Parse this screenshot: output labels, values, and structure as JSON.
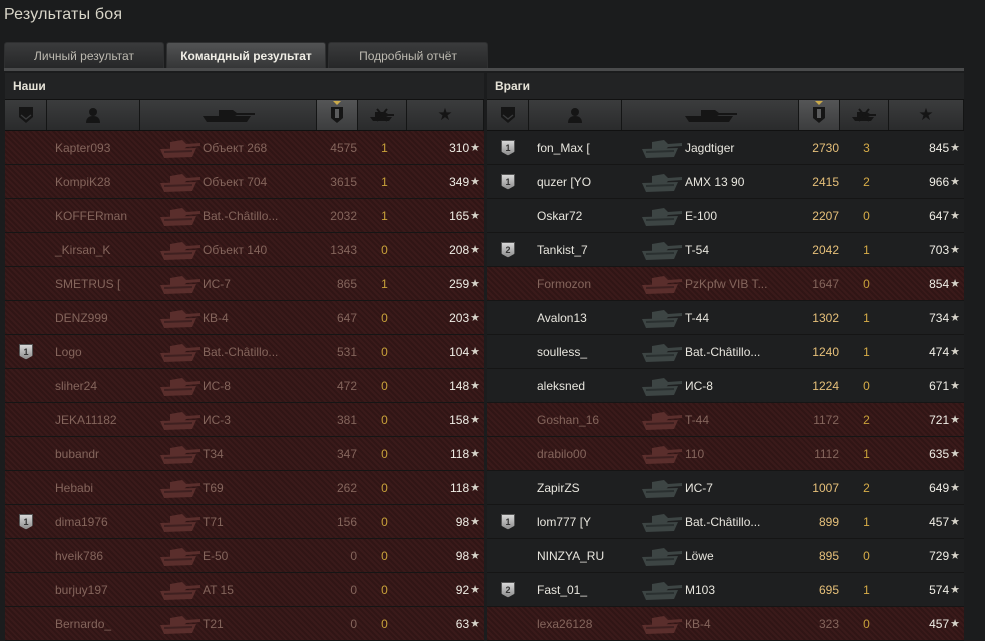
{
  "window": {
    "title": "Результаты боя"
  },
  "tabs": [
    {
      "label": "Личный результат",
      "active": false
    },
    {
      "label": "Командный результат",
      "active": true
    },
    {
      "label": "Подробный отчёт",
      "active": false
    }
  ],
  "columns": [
    "badge-icon",
    "player-icon",
    "tank-icon",
    "damage-icon",
    "kills-icon",
    "xp-star-icon"
  ],
  "ours": {
    "title": "Наши",
    "rows": [
      {
        "badge": "",
        "name": "Kapter093",
        "tank": "Объект 268",
        "damage": "4575",
        "kills": "1",
        "xp": "310",
        "alive": false
      },
      {
        "badge": "",
        "name": "KompiK28",
        "tank": "Объект 704",
        "damage": "3615",
        "kills": "1",
        "xp": "349",
        "alive": false
      },
      {
        "badge": "",
        "name": "KOFFERman",
        "tank": "Bat.-Châtillo...",
        "damage": "2032",
        "kills": "1",
        "xp": "165",
        "alive": false
      },
      {
        "badge": "",
        "name": "_Kirsan_K",
        "tank": "Объект 140",
        "damage": "1343",
        "kills": "0",
        "xp": "208",
        "alive": false
      },
      {
        "badge": "",
        "name": "SMETRUS [",
        "tank": "ИС-7",
        "damage": "865",
        "kills": "1",
        "xp": "259",
        "alive": false
      },
      {
        "badge": "",
        "name": "DENZ999",
        "tank": "КВ-4",
        "damage": "647",
        "kills": "0",
        "xp": "203",
        "alive": false
      },
      {
        "badge": "1",
        "name": "Logo",
        "tank": "Bat.-Châtillo...",
        "damage": "531",
        "kills": "0",
        "xp": "104",
        "alive": false
      },
      {
        "badge": "",
        "name": "sliher24",
        "tank": "ИС-8",
        "damage": "472",
        "kills": "0",
        "xp": "148",
        "alive": false
      },
      {
        "badge": "",
        "name": "JEKA11182",
        "tank": "ИС-3",
        "damage": "381",
        "kills": "0",
        "xp": "158",
        "alive": false
      },
      {
        "badge": "",
        "name": "bubandr",
        "tank": "T34",
        "damage": "347",
        "kills": "0",
        "xp": "118",
        "alive": false
      },
      {
        "badge": "",
        "name": "Hebabi",
        "tank": "T69",
        "damage": "262",
        "kills": "0",
        "xp": "118",
        "alive": false
      },
      {
        "badge": "1",
        "name": "dima1976",
        "tank": "T71",
        "damage": "156",
        "kills": "0",
        "xp": "98",
        "alive": false
      },
      {
        "badge": "",
        "name": "hveik786",
        "tank": "E-50",
        "damage": "0",
        "kills": "0",
        "xp": "98",
        "alive": false
      },
      {
        "badge": "",
        "name": "burjuy197",
        "tank": "AT 15",
        "damage": "0",
        "kills": "0",
        "xp": "92",
        "alive": false
      },
      {
        "badge": "",
        "name": "Bernardo_",
        "tank": "T21",
        "damage": "0",
        "kills": "0",
        "xp": "63",
        "alive": false
      }
    ]
  },
  "enemies": {
    "title": "Враги",
    "rows": [
      {
        "badge": "1",
        "name": "fon_Max [",
        "tank": "Jagdtiger",
        "damage": "2730",
        "kills": "3",
        "xp": "845",
        "alive": true
      },
      {
        "badge": "1",
        "name": "quzer [YO",
        "tank": "AMX 13 90",
        "damage": "2415",
        "kills": "2",
        "xp": "966",
        "alive": true
      },
      {
        "badge": "",
        "name": "Oskar72",
        "tank": "E-100",
        "damage": "2207",
        "kills": "0",
        "xp": "647",
        "alive": true
      },
      {
        "badge": "2",
        "name": "Tankist_7",
        "tank": "T-54",
        "damage": "2042",
        "kills": "1",
        "xp": "703",
        "alive": true
      },
      {
        "badge": "",
        "name": "Formozon",
        "tank": "PzKpfw VIB T...",
        "damage": "1647",
        "kills": "0",
        "xp": "854",
        "alive": false
      },
      {
        "badge": "",
        "name": "Avalon13",
        "tank": "T-44",
        "damage": "1302",
        "kills": "1",
        "xp": "734",
        "alive": true
      },
      {
        "badge": "",
        "name": "soulless_",
        "tank": "Bat.-Châtillo...",
        "damage": "1240",
        "kills": "1",
        "xp": "474",
        "alive": true
      },
      {
        "badge": "",
        "name": "aleksned",
        "tank": "ИС-8",
        "damage": "1224",
        "kills": "0",
        "xp": "671",
        "alive": true
      },
      {
        "badge": "",
        "name": "Goshan_16",
        "tank": "T-44",
        "damage": "1172",
        "kills": "2",
        "xp": "721",
        "alive": false
      },
      {
        "badge": "",
        "name": "drabilo00",
        "tank": "110",
        "damage": "1112",
        "kills": "1",
        "xp": "635",
        "alive": false
      },
      {
        "badge": "",
        "name": "ZapirZS",
        "tank": "ИС-7",
        "damage": "1007",
        "kills": "2",
        "xp": "649",
        "alive": true
      },
      {
        "badge": "1",
        "name": "lom777 [Y",
        "tank": "Bat.-Châtillo...",
        "damage": "899",
        "kills": "1",
        "xp": "457",
        "alive": true
      },
      {
        "badge": "",
        "name": "NINZYA_RU",
        "tank": "Löwe",
        "damage": "895",
        "kills": "0",
        "xp": "729",
        "alive": true
      },
      {
        "badge": "2",
        "name": "Fast_01_",
        "tank": "M103",
        "damage": "695",
        "kills": "1",
        "xp": "574",
        "alive": true
      },
      {
        "badge": "",
        "name": "lexa26128",
        "tank": "КВ-4",
        "damage": "323",
        "kills": "0",
        "xp": "457",
        "alive": false
      }
    ]
  },
  "colors": {
    "dead_row": "#3a1a1a",
    "alive_row": "#1e1f20",
    "kills": "#d8ad48",
    "damage": "#e6c07a"
  }
}
